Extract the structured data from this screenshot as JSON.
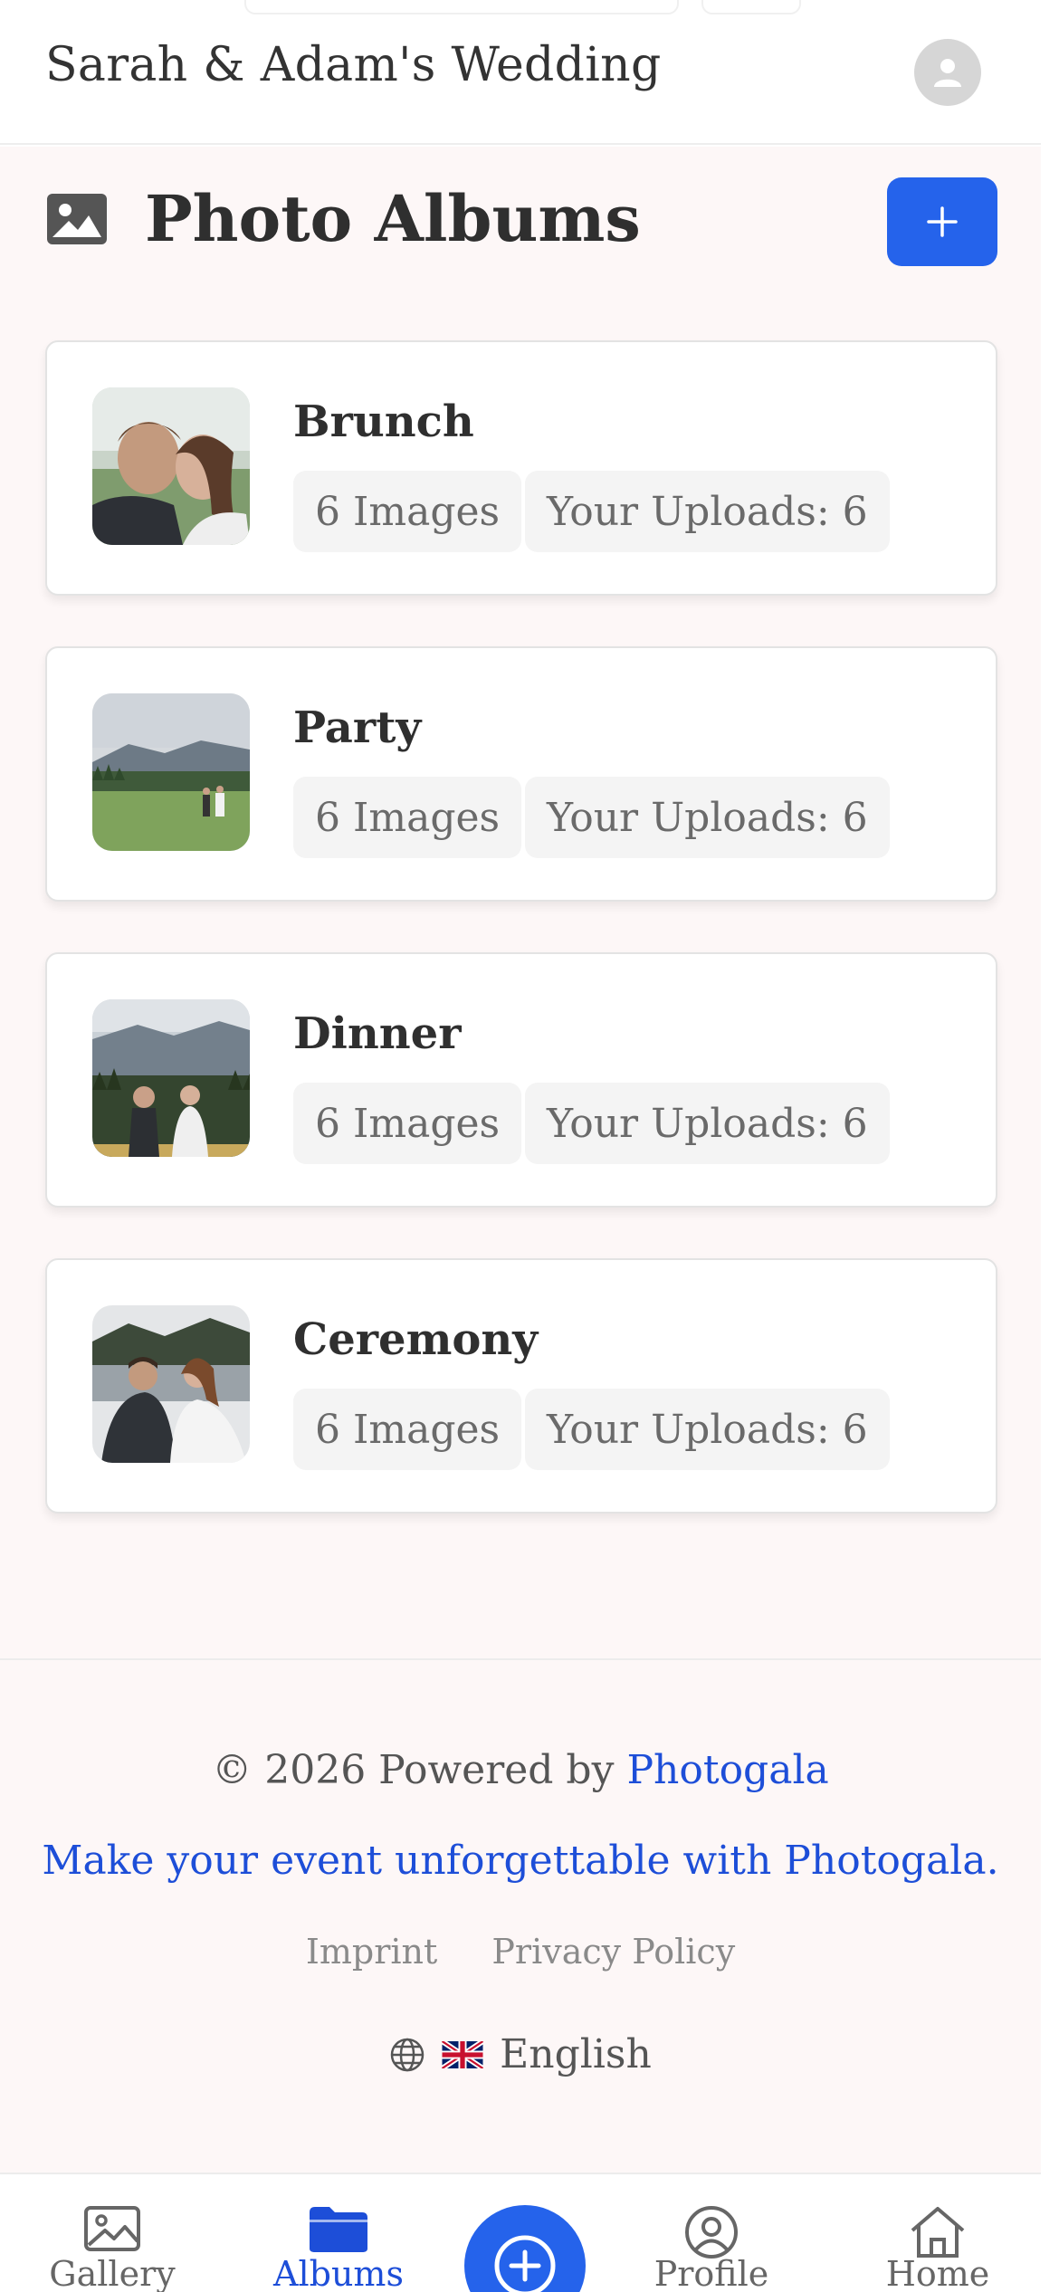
{
  "header": {
    "title": "Sarah & Adam's Wedding"
  },
  "page": {
    "title": "Photo Albums"
  },
  "albums": [
    {
      "name": "Brunch",
      "images": "6 Images",
      "uploads": "Your Uploads: 6"
    },
    {
      "name": "Party",
      "images": "6 Images",
      "uploads": "Your Uploads: 6"
    },
    {
      "name": "Dinner",
      "images": "6 Images",
      "uploads": "Your Uploads: 6"
    },
    {
      "name": "Ceremony",
      "images": "6 Images",
      "uploads": "Your Uploads: 6"
    }
  ],
  "footer": {
    "copyright_prefix": "© 2026 Powered by",
    "brand_link": "Photogala",
    "tagline": "Make your event unforgettable with Photogala.",
    "imprint": "Imprint",
    "privacy": "Privacy Policy",
    "language": "English"
  },
  "nav": {
    "gallery": "Gallery",
    "albums": "Albums",
    "profile": "Profile",
    "home": "Home"
  },
  "colors": {
    "accent": "#2563eb",
    "link": "#1d4ed8",
    "background": "#fdf7f7"
  },
  "icons": {
    "title": "image-icon",
    "add": "plus-icon",
    "avatar": "user-icon",
    "language": "globe-icon",
    "flag": "uk-flag-icon",
    "fab": "plus-circle-icon"
  }
}
